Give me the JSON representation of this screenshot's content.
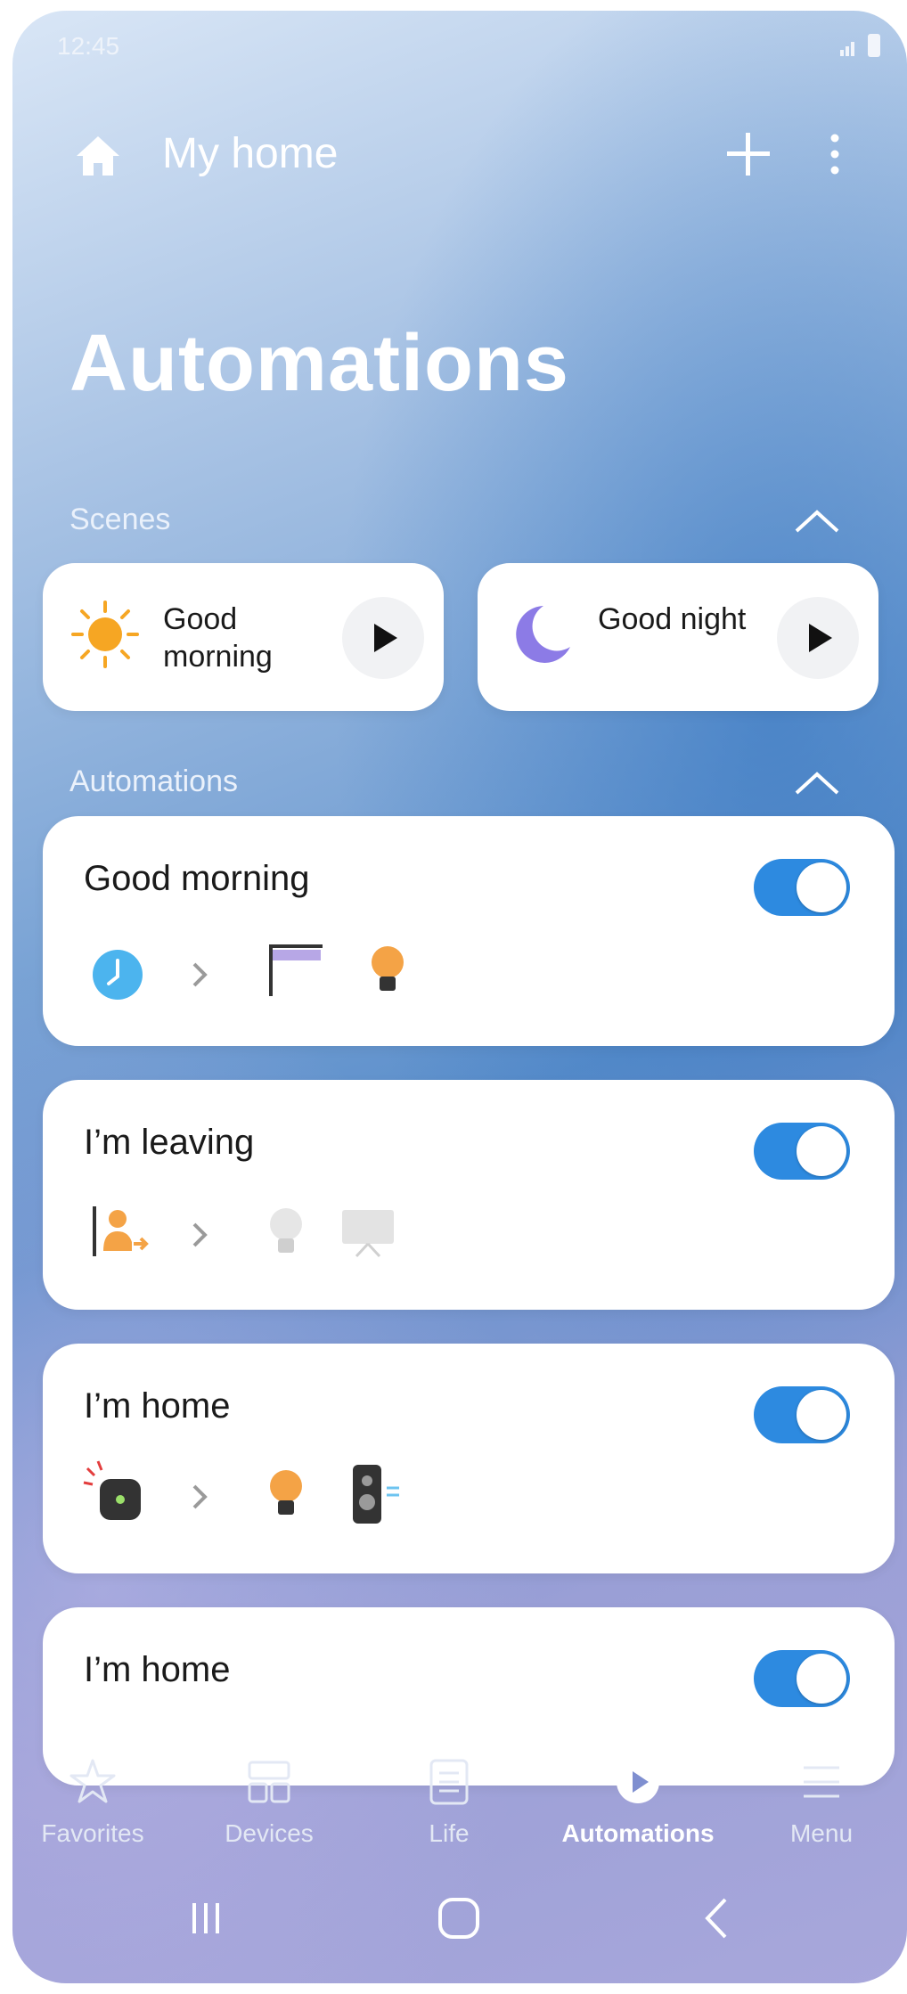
{
  "status": {
    "time": "12:45"
  },
  "header": {
    "title": "My home"
  },
  "page": {
    "title": "Automations"
  },
  "scenes": {
    "label": "Scenes",
    "items": [
      {
        "label": "Good morning",
        "icon": "sun-icon"
      },
      {
        "label": "Good night",
        "icon": "moon-icon"
      }
    ]
  },
  "automations": {
    "label": "Automations",
    "items": [
      {
        "title": "Good morning",
        "enabled": true,
        "trigger_icons": [
          "clock-icon"
        ],
        "action_icons": [
          "blinds-icon",
          "bulb-icon"
        ]
      },
      {
        "title": "I’m leaving",
        "enabled": true,
        "trigger_icons": [
          "person-leaving-icon"
        ],
        "action_icons": [
          "bulb-off-icon",
          "tv-icon"
        ]
      },
      {
        "title": "I’m home",
        "enabled": true,
        "trigger_icons": [
          "sensor-icon"
        ],
        "action_icons": [
          "bulb-icon",
          "speaker-icon"
        ]
      },
      {
        "title": "I’m home",
        "enabled": true,
        "trigger_icons": [],
        "action_icons": []
      }
    ]
  },
  "nav": {
    "items": [
      {
        "label": "Favorites",
        "icon": "star-icon"
      },
      {
        "label": "Devices",
        "icon": "devices-icon"
      },
      {
        "label": "Life",
        "icon": "life-icon"
      },
      {
        "label": "Automations",
        "icon": "automations-icon",
        "active": true
      },
      {
        "label": "Menu",
        "icon": "menu-icon"
      }
    ]
  },
  "colors": {
    "toggle_on": "#2d8ae0",
    "card": "#ffffff",
    "sun": "#f6a623",
    "moon": "#8c7be6"
  }
}
